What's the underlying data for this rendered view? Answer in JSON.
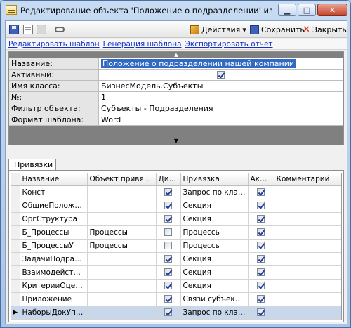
{
  "window": {
    "title": "Редактирование объекта 'Положение о подразделении' из Отчеты объектов",
    "min_glyph": "▁",
    "max_glyph": "□",
    "close_glyph": "✕"
  },
  "toolbar": {
    "actions_label": "Действия",
    "actions_arrow": "▾",
    "save_label": "Сохранить",
    "close_label": "Закрыть",
    "close_glyph": "✕"
  },
  "links": {
    "edit_template": "Редактировать шаблон",
    "generate_template": "Генерация шаблона",
    "export_report": "Экспортировать отчет"
  },
  "properties": {
    "scroll_up_glyph": "▲",
    "scroll_down_glyph": "▼",
    "rows": [
      {
        "name": "Название:",
        "value": "Положение о подразделении нашей компании"
      },
      {
        "name": "Активный:",
        "value": "",
        "checked": true
      },
      {
        "name": "Имя класса:",
        "value": "БизнесМодель.Субъекты"
      },
      {
        "name": "№:",
        "value": "1"
      },
      {
        "name": "Фильтр объекта:",
        "value": "Субъекты - Подразделения"
      },
      {
        "name": "Формат шаблона:",
        "value": "Word"
      }
    ]
  },
  "tabs": {
    "bindings_label": "Привязки"
  },
  "grid": {
    "columns": {
      "name": "Название",
      "object": "Объект привязки",
      "dynamic": "Дина...",
      "binding": "Привязка",
      "active": "Акти...",
      "comment": "Комментарий"
    },
    "current_marker": "▶",
    "new_marker": "*",
    "rows": [
      {
        "name": "Конст",
        "object": "",
        "dynamic": true,
        "binding": "Запрос по классу...",
        "active": true
      },
      {
        "name": "ОбщиеПоложения",
        "object": "",
        "dynamic": true,
        "binding": "Секция",
        "active": true
      },
      {
        "name": "ОргСтруктура",
        "object": "",
        "dynamic": true,
        "binding": "Секция",
        "active": true
      },
      {
        "name": "Б_Процессы",
        "object": "Процессы",
        "dynamic": false,
        "binding": "Процессы",
        "active": true
      },
      {
        "name": "Б_ПроцессыУ",
        "object": "Процессы",
        "dynamic": false,
        "binding": "Процессы",
        "active": true
      },
      {
        "name": "ЗадачиПодразде...",
        "object": "",
        "dynamic": true,
        "binding": "Секция",
        "active": true
      },
      {
        "name": "Взаимодействие",
        "object": "",
        "dynamic": true,
        "binding": "Секция",
        "active": true
      },
      {
        "name": "КритерииОценки",
        "object": "",
        "dynamic": true,
        "binding": "Секция",
        "active": true
      },
      {
        "name": "Приложение",
        "object": "",
        "dynamic": true,
        "binding": "Связи субъекта п...",
        "active": true
      },
      {
        "name": "НаборыДокУпрІd...",
        "object": "",
        "dynamic": true,
        "binding": "Запрос по классу...",
        "active": true
      }
    ]
  }
}
